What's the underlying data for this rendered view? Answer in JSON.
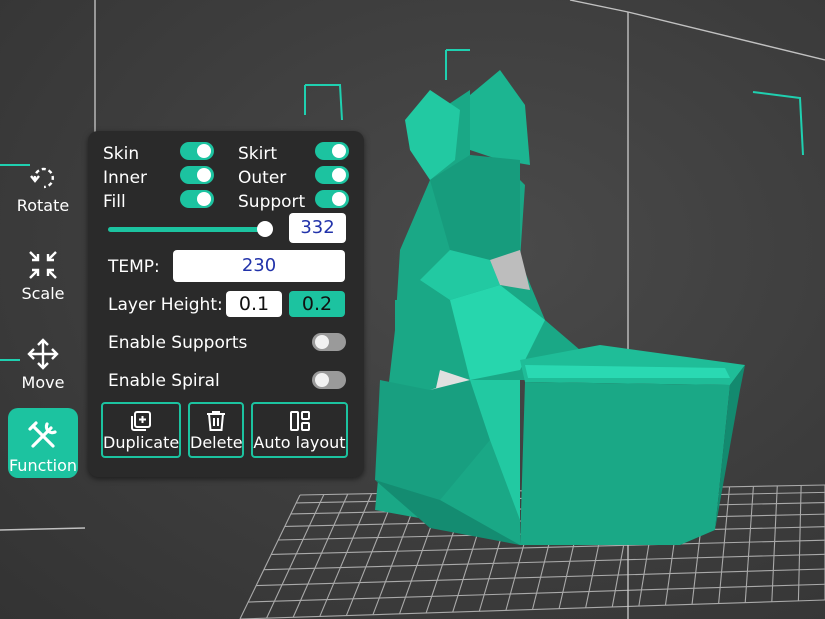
{
  "tools": [
    {
      "id": "rotate",
      "label": "Rotate",
      "icon": "rotate-icon",
      "active": false
    },
    {
      "id": "scale",
      "label": "Scale",
      "icon": "scale-icon",
      "active": false
    },
    {
      "id": "move",
      "label": "Move",
      "icon": "move-icon",
      "active": false
    },
    {
      "id": "function",
      "label": "Function",
      "icon": "function-icon",
      "active": true
    }
  ],
  "panel": {
    "toggles": [
      {
        "label": "Skin",
        "on": true
      },
      {
        "label": "Skirt",
        "on": true
      },
      {
        "label": "Inner",
        "on": true
      },
      {
        "label": "Outer",
        "on": true
      },
      {
        "label": "Fill",
        "on": true
      },
      {
        "label": "Support",
        "on": true
      }
    ],
    "slider_value": "332",
    "temp_label": "TEMP:",
    "temp_value": "230",
    "layer_height_label": "Layer Height:",
    "layer_height_options": [
      "0.1",
      "0.2"
    ],
    "layer_height_selected": "0.2",
    "enable_supports_label": "Enable Supports",
    "enable_supports_on": false,
    "enable_spiral_label": "Enable Spiral",
    "enable_spiral_on": false,
    "buttons": [
      {
        "label": "Duplicate",
        "icon": "duplicate-icon"
      },
      {
        "label": "Delete",
        "icon": "trash-icon"
      },
      {
        "label": "Auto layout",
        "icon": "layout-icon"
      }
    ]
  },
  "colors": {
    "accent": "#1cc3a0",
    "panel_bg": "#2a2a2a",
    "viewport_bg": "#3d3d3d",
    "grid": "#1fd0b0"
  }
}
